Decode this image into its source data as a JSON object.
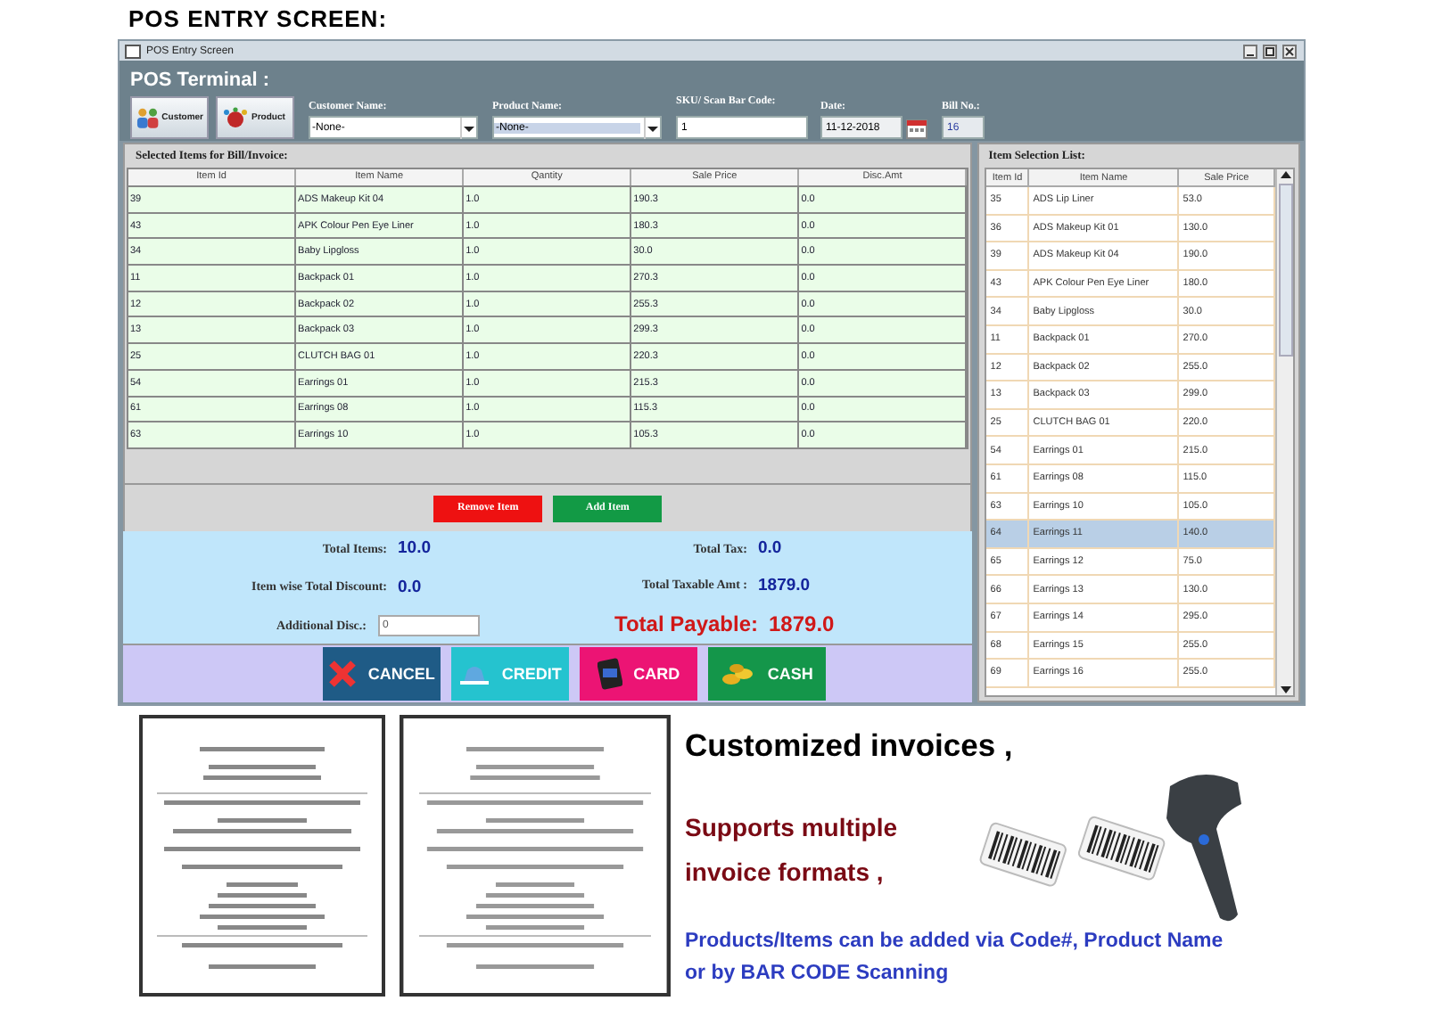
{
  "page_title": "POS ENTRY SCREEN:",
  "window": {
    "title": "POS Entry Screen",
    "heading": "POS Terminal :"
  },
  "toolbar_buttons": [
    {
      "label": "Customer",
      "kind": "customer"
    },
    {
      "label": "Product",
      "kind": "product"
    }
  ],
  "fields": [
    {
      "label": "Customer Name:",
      "value": "-None-",
      "kind": "dropdown",
      "selected": false
    },
    {
      "label": "Product Name:",
      "value": "-None-",
      "kind": "dropdown",
      "selected": true
    },
    {
      "label": "SKU/ Scan Bar Code:",
      "value": "1",
      "kind": "text"
    },
    {
      "label": "Date:",
      "value": "11-12-2018",
      "kind": "date"
    },
    {
      "label": "Bill No.:",
      "value": "16",
      "kind": "readonly"
    }
  ],
  "bill_items": {
    "title": "Selected Items for Bill/Invoice:",
    "columns": [
      "Item Id",
      "Item Name",
      "Qantity",
      "Sale Price",
      "Disc.Amt"
    ],
    "rows": [
      [
        "39",
        "ADS Makeup Kit 04",
        "1.0",
        "190.3",
        "0.0"
      ],
      [
        "43",
        "APK Colour Pen Eye Liner",
        "1.0",
        "180.3",
        "0.0"
      ],
      [
        "34",
        "Baby Lipgloss",
        "1.0",
        "30.0",
        "0.0"
      ],
      [
        "11",
        "Backpack 01",
        "1.0",
        "270.3",
        "0.0"
      ],
      [
        "12",
        "Backpack 02",
        "1.0",
        "255.3",
        "0.0"
      ],
      [
        "13",
        "Backpack 03",
        "1.0",
        "299.3",
        "0.0"
      ],
      [
        "25",
        "CLUTCH BAG 01",
        "1.0",
        "220.3",
        "0.0"
      ],
      [
        "54",
        "Earrings 01",
        "1.0",
        "215.3",
        "0.0"
      ],
      [
        "61",
        "Earrings 08",
        "1.0",
        "115.3",
        "0.0"
      ],
      [
        "63",
        "Earrings 10",
        "1.0",
        "105.3",
        "0.0"
      ]
    ]
  },
  "item_actions": [
    {
      "label": "Remove Item",
      "color": "#ee1111"
    },
    {
      "label": "Add Item",
      "color": "#129a45"
    }
  ],
  "summary_left": [
    {
      "label": "Total Items:",
      "value": "10.0",
      "kind": "value"
    },
    {
      "label": "Item wise Total Discount:",
      "value": "0.0",
      "kind": "value"
    },
    {
      "label": "Additional Disc.:",
      "value": "0",
      "kind": "input"
    }
  ],
  "summary_right": [
    {
      "label": "Total Tax:",
      "value": "0.0",
      "kind": "value"
    },
    {
      "label": "Total Taxable Amt :",
      "value": "1879.0",
      "kind": "value"
    },
    {
      "label": "Total Payable:",
      "value": "1879.0",
      "kind": "total"
    }
  ],
  "payment_buttons": [
    {
      "label": "CANCEL",
      "kind": "cancel",
      "color": "#1f5b86"
    },
    {
      "label": "CREDIT",
      "kind": "credit",
      "color": "#25c3cf"
    },
    {
      "label": "CARD",
      "kind": "card",
      "color": "#ec1474"
    },
    {
      "label": "CASH",
      "kind": "cash",
      "color": "#14964a"
    }
  ],
  "item_list": {
    "title": "Item Selection List:",
    "columns": [
      "Item Id",
      "Item Name",
      "Sale Price"
    ],
    "rows": [
      {
        "cells": [
          "35",
          "ADS Lip Liner",
          "53.0"
        ],
        "selected": false
      },
      {
        "cells": [
          "36",
          "ADS Makeup Kit 01",
          "130.0"
        ],
        "selected": false
      },
      {
        "cells": [
          "39",
          "ADS Makeup Kit 04",
          "190.0"
        ],
        "selected": false
      },
      {
        "cells": [
          "43",
          "APK Colour Pen Eye Liner",
          "180.0"
        ],
        "selected": false
      },
      {
        "cells": [
          "34",
          "Baby Lipgloss",
          "30.0"
        ],
        "selected": false
      },
      {
        "cells": [
          "11",
          "Backpack 01",
          "270.0"
        ],
        "selected": false
      },
      {
        "cells": [
          "12",
          "Backpack 02",
          "255.0"
        ],
        "selected": false
      },
      {
        "cells": [
          "13",
          "Backpack 03",
          "299.0"
        ],
        "selected": false
      },
      {
        "cells": [
          "25",
          "CLUTCH BAG 01",
          "220.0"
        ],
        "selected": false
      },
      {
        "cells": [
          "54",
          "Earrings 01",
          "215.0"
        ],
        "selected": false
      },
      {
        "cells": [
          "61",
          "Earrings 08",
          "115.0"
        ],
        "selected": false
      },
      {
        "cells": [
          "63",
          "Earrings 10",
          "105.0"
        ],
        "selected": false
      },
      {
        "cells": [
          "64",
          "Earrings 11",
          "140.0"
        ],
        "selected": true
      },
      {
        "cells": [
          "65",
          "Earrings 12",
          "75.0"
        ],
        "selected": false
      },
      {
        "cells": [
          "66",
          "Earrings 13",
          "130.0"
        ],
        "selected": false
      },
      {
        "cells": [
          "67",
          "Earrings 14",
          "295.0"
        ],
        "selected": false
      },
      {
        "cells": [
          "68",
          "Earrings 15",
          "255.0"
        ],
        "selected": false
      },
      {
        "cells": [
          "69",
          "Earrings 16",
          "255.0"
        ],
        "selected": false
      }
    ]
  },
  "promo": {
    "heading": "Customized invoices ,",
    "subheading": "Supports multiple invoice formats ,",
    "note": "Products/Items can be added via Code#, Product Name or by BAR CODE Scanning"
  }
}
